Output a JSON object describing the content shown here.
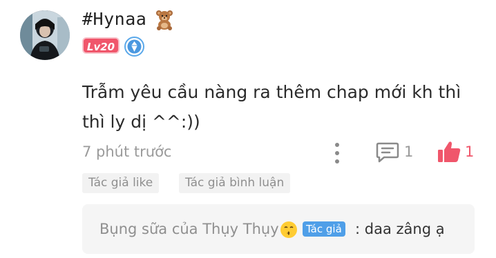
{
  "comment": {
    "username": "#Hynaa",
    "username_emoji_icon": "teddy-bear-icon",
    "level_badge": "Lv20",
    "verified_icon": "blue-diamond-badge-icon",
    "text": "Trẫm yêu cầu nàng ra thêm chap mới kh thì thì ly dị ^^:))",
    "time": "7 phút trước",
    "reply_count": "1",
    "like_count": "1",
    "like_color": "#f0566b"
  },
  "chips": {
    "author_like": "Tác giả like",
    "author_reply": "Tác giả bình luận"
  },
  "reply": {
    "author": "Bụng sữa của Thụy Thụy",
    "author_emoji_icon": "kissing-face-icon",
    "author_tag": "Tác giả",
    "separator": ":",
    "text": "daa zâng ạ"
  },
  "colors": {
    "badge": "#f0566b",
    "author_tag": "#4f9fe8",
    "muted_text": "#9a9a9a"
  }
}
